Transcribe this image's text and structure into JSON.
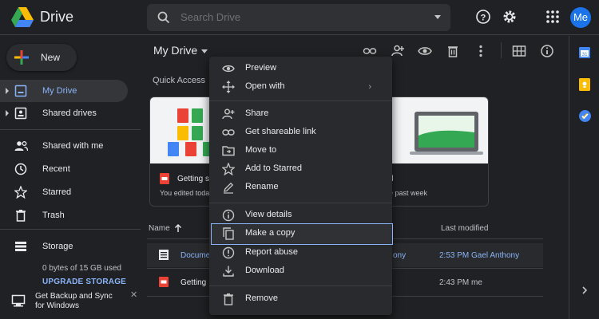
{
  "header": {
    "app_title": "Drive",
    "search_placeholder": "Search Drive",
    "avatar_initials": "Me"
  },
  "sidebar": {
    "new_label": "New",
    "items": [
      {
        "label": "My Drive",
        "icon": "my-drive-icon",
        "active": true
      },
      {
        "label": "Shared drives",
        "icon": "shared-drives-icon"
      },
      {
        "label": "Shared with me",
        "icon": "people-icon"
      },
      {
        "label": "Recent",
        "icon": "clock-icon"
      },
      {
        "label": "Starred",
        "icon": "star-icon"
      },
      {
        "label": "Trash",
        "icon": "trash-icon"
      },
      {
        "label": "Storage",
        "icon": "storage-icon"
      }
    ],
    "storage_used": "0 bytes of 15 GB used",
    "upgrade_label": "UPGRADE STORAGE",
    "backup_text": "Get Backup and Sync for Windows"
  },
  "main": {
    "title": "My Drive",
    "quick_access_label": "Quick Access",
    "cards": [
      {
        "title": "Getting st",
        "subtitle": "You edited toda"
      },
      {
        "title": "d",
        "subtitle": "e past week"
      }
    ],
    "columns": {
      "name": "Name",
      "last_modified": "Last modified"
    },
    "files": [
      {
        "name": "Docume",
        "owner": "ony",
        "modified": "2:53 PM  Gael Anthony",
        "selected": true
      },
      {
        "name": "Getting",
        "owner": "",
        "modified": "2:43 PM  me",
        "selected": false
      }
    ]
  },
  "context_menu": {
    "items": [
      {
        "label": "Preview",
        "icon": "eye-icon"
      },
      {
        "label": "Open with",
        "icon": "open-with-icon",
        "submenu": true
      },
      {
        "label": "Share",
        "icon": "person-add-icon"
      },
      {
        "label": "Get shareable link",
        "icon": "link-icon"
      },
      {
        "label": "Move to",
        "icon": "folder-move-icon"
      },
      {
        "label": "Add to Starred",
        "icon": "star-icon"
      },
      {
        "label": "Rename",
        "icon": "pencil-icon"
      },
      {
        "label": "View details",
        "icon": "info-icon"
      },
      {
        "label": "Make a copy",
        "icon": "copy-icon",
        "highlighted": true
      },
      {
        "label": "Report abuse",
        "icon": "alert-icon"
      },
      {
        "label": "Download",
        "icon": "download-icon"
      },
      {
        "label": "Remove",
        "icon": "trash-icon"
      }
    ]
  },
  "colors": {
    "background": "#202124",
    "accent": "#8ab4f8",
    "menu_background": "#292a2d",
    "avatar": "#1a73e8"
  }
}
